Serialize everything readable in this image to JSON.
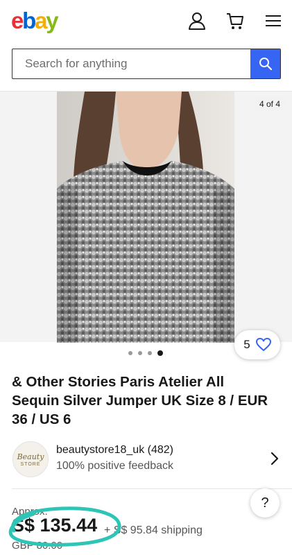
{
  "header": {
    "logo_letters": [
      "e",
      "b",
      "a",
      "y"
    ],
    "icons": [
      "account-icon",
      "cart-icon",
      "menu-icon"
    ]
  },
  "search": {
    "placeholder": "Search for anything",
    "button_icon": "search-icon"
  },
  "gallery": {
    "counter": "4 of 4",
    "total_images": 4,
    "active_index": 4,
    "watch_count": "5",
    "watch_icon": "heart-icon"
  },
  "product": {
    "title": "& Other Stories Paris Atelier All Sequin Silver Jumper UK Size 8 / EUR 36 / US 6"
  },
  "seller": {
    "avatar_text_1": "Beauty",
    "avatar_text_2": "STORE",
    "name": "beautystore18_uk (482)",
    "feedback": "100% positive feedback"
  },
  "pricing": {
    "approx_label": "Approx.",
    "price": "S$ 135.44",
    "shipping": "+ S$ 95.84 shipping",
    "original_price": "GBP 80.00"
  },
  "help": {
    "label": "?"
  },
  "colors": {
    "accent": "#3665f3",
    "annotation": "#2ec4b6"
  }
}
